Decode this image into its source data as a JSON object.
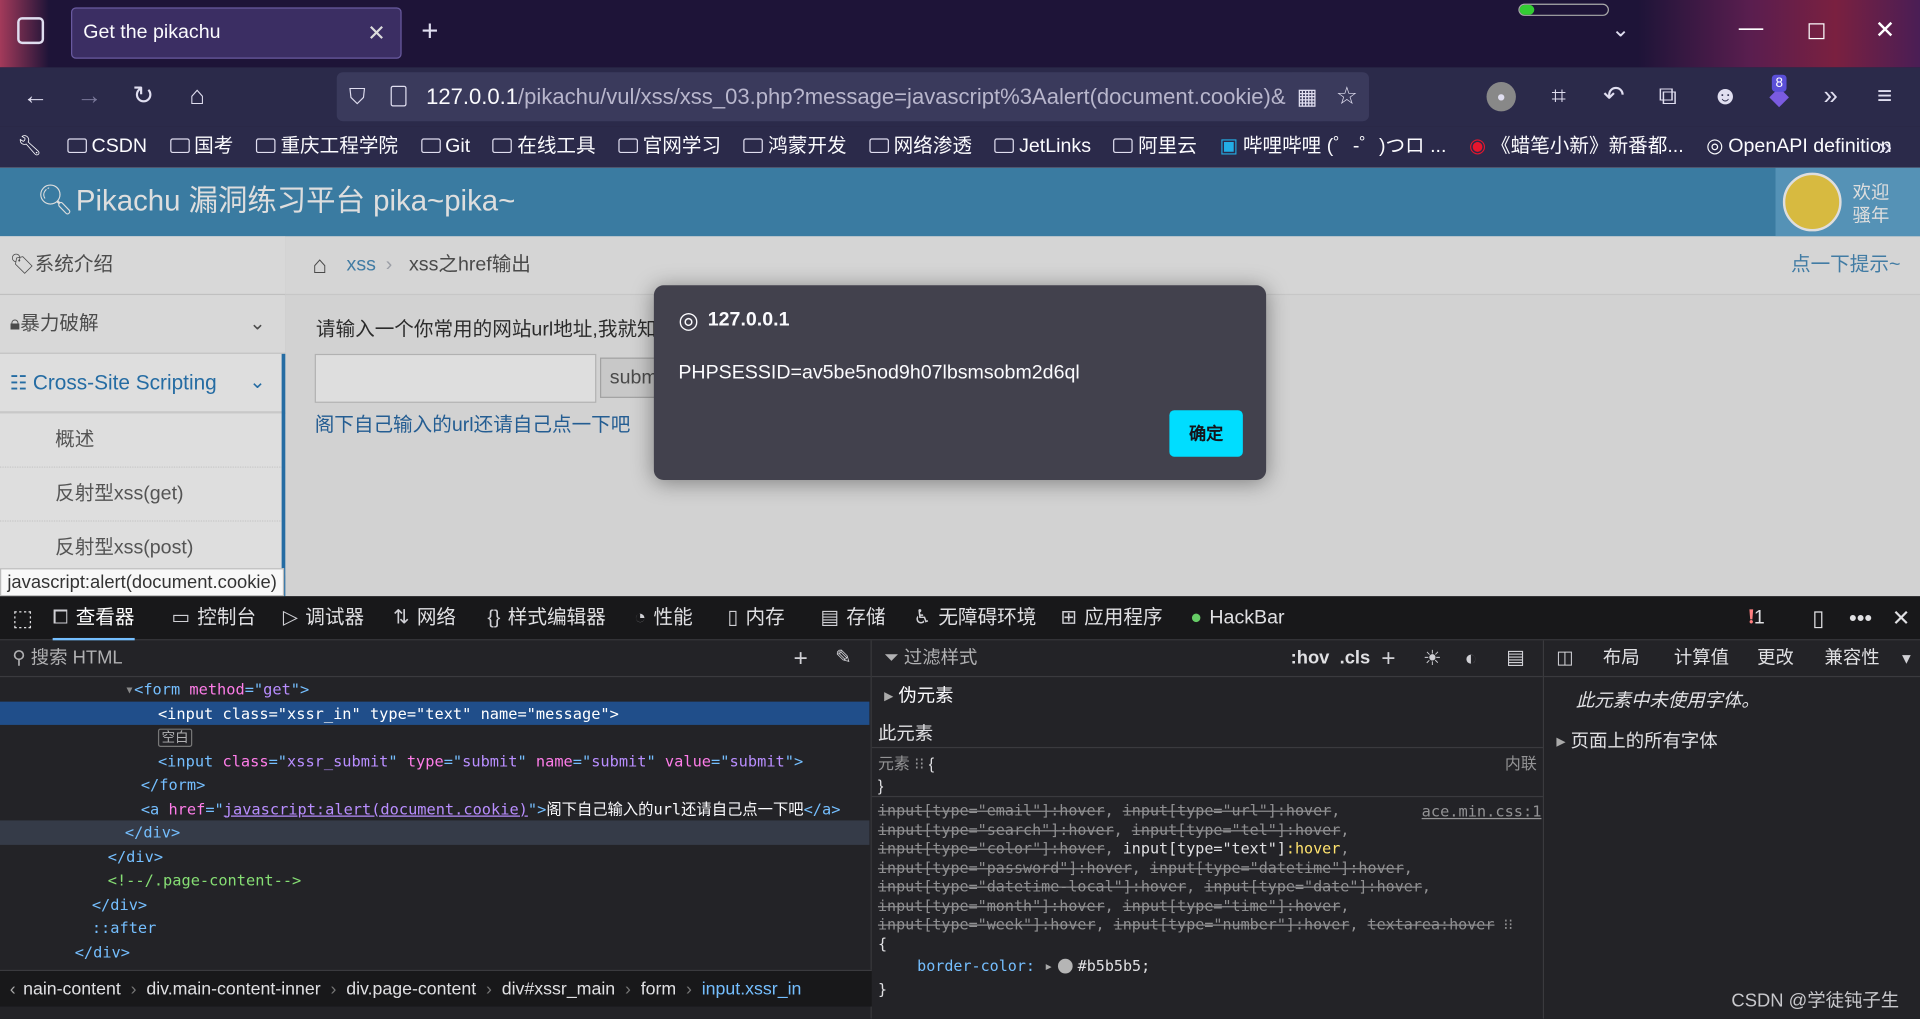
{
  "browser": {
    "tab_title": "Get the pikachu",
    "url_host": "127.0.0.1",
    "url_rest": "/pikachu/vul/xss/xss_03.php?message=javascript%3Aalert(document.cookie)&",
    "badge_count": "8",
    "bookmarks": [
      "CSDN",
      "国考",
      "重庆工程学院",
      "Git",
      "在线工具",
      "官网学习",
      "鸿蒙开发",
      "网络渗透",
      "JetLinks",
      "阿里云",
      "哔哩哔哩 (゜-゜)つロ ...",
      "《蜡笔小新》新番都...",
      "OpenAPI definition"
    ]
  },
  "page": {
    "title": "Pikachu 漏洞练习平台 pika~pika~",
    "welcome_line1": "欢迎",
    "welcome_line2": "骚年",
    "sidebar": {
      "intro": "系统介绍",
      "brute": "暴力破解",
      "xss": "Cross-Site Scripting",
      "sub1": "概述",
      "sub2": "反射型xss(get)",
      "sub3": "反射型xss(post)"
    },
    "breadcrumb": {
      "root": "xss",
      "current": "xss之href输出",
      "hint": "点一下提示~"
    },
    "prompt": "请输入一个你常用的网站url地址,我就知",
    "submit_label": "subm",
    "link_text": "阁下自己输入的url还请自己点一下吧",
    "status_url": "javascript:alert(document.cookie)"
  },
  "dialog": {
    "origin": "127.0.0.1",
    "message": "PHPSESSID=av5be5nod9h07lbsmsobm2d6ql",
    "ok": "确定"
  },
  "devtools": {
    "tabs": [
      "查看器",
      "控制台",
      "调试器",
      "网络",
      "样式编辑器",
      "性能",
      "内存",
      "存储",
      "无障碍环境",
      "应用程序",
      "HackBar"
    ],
    "error_count": "1",
    "search_html": "搜索 HTML",
    "filter_styles": "过滤样式",
    "hov": ":hov",
    "cls": ".cls",
    "pseudo": "伪元素",
    "this_element": "此元素",
    "element_label": "元素",
    "inline_label": "内联",
    "source": "ace.min.css:1",
    "border_prop": "border-color:",
    "border_val": "#b5b5b5;",
    "right_tabs": [
      "布局",
      "计算值",
      "更改",
      "兼容性"
    ],
    "fonts_note": "此元素中未使用字体。",
    "all_fonts": "页面上的所有字体",
    "whitespace_badge": "空白",
    "breadcrumbs": [
      "nain-content",
      "div.main-content-inner",
      "div.page-content",
      "div#xssr_main",
      "form",
      "input.xssr_in"
    ],
    "watermark": "CSDN @学徒钝子生"
  },
  "colors": {
    "header_blue": "#438eb9",
    "dialog_bg": "#42414d",
    "ok_button": "#00ddff",
    "selection": "#204e8a"
  }
}
